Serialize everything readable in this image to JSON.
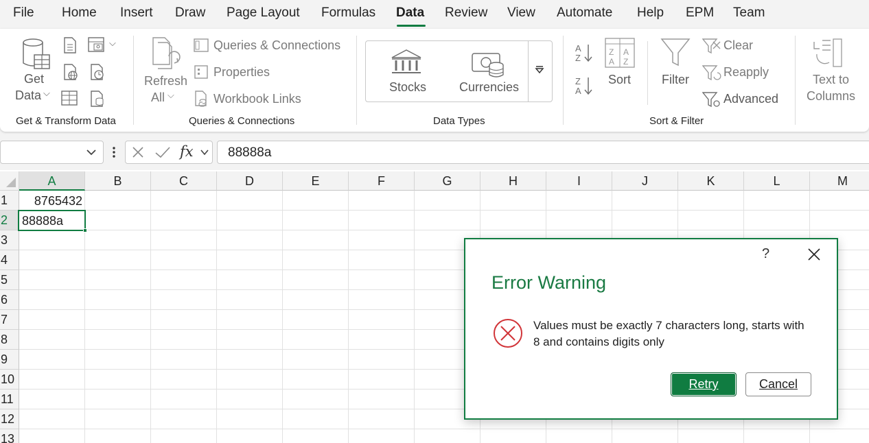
{
  "menu": {
    "items": [
      "File",
      "Home",
      "Insert",
      "Draw",
      "Page Layout",
      "Formulas",
      "Data",
      "Review",
      "View",
      "Automate",
      "Help",
      "EPM",
      "Team"
    ],
    "active": "Data"
  },
  "ribbon": {
    "get_data": {
      "line1": "Get",
      "line2": "Data"
    },
    "refresh_all": {
      "line1": "Refresh",
      "line2": "All"
    },
    "queries_connections": "Queries & Connections",
    "properties": "Properties",
    "workbook_links": "Workbook Links",
    "stocks": "Stocks",
    "currencies": "Currencies",
    "sort": "Sort",
    "filter": "Filter",
    "clear": "Clear",
    "reapply": "Reapply",
    "advanced": "Advanced",
    "text_to_columns": {
      "line1": "Text to",
      "line2": "Columns"
    },
    "groups": {
      "get_transform": "Get & Transform Data",
      "queries": "Queries & Connections",
      "data_types": "Data Types",
      "sort_filter": "Sort & Filter"
    }
  },
  "formula_bar": {
    "name_box": "",
    "fx_label": "fx",
    "value": "88888a"
  },
  "sheet": {
    "columns": [
      "A",
      "B",
      "C",
      "D",
      "E",
      "F",
      "G",
      "H",
      "I",
      "J",
      "K",
      "L",
      "M"
    ],
    "rows": [
      "1",
      "2",
      "3",
      "4",
      "5",
      "6",
      "7",
      "8",
      "9",
      "10",
      "11",
      "12",
      "13"
    ],
    "cells": {
      "A1": "8765432",
      "A2": "88888a"
    },
    "active_cell": "A2"
  },
  "dialog": {
    "help": "?",
    "title": "Error Warning",
    "message": "Values must be exactly 7 characters long, starts with 8 and contains digits only",
    "retry_label": "Retry",
    "cancel_label": "Cancel"
  },
  "colors": {
    "accent": "#107c41",
    "error_icon": "#d13438"
  }
}
